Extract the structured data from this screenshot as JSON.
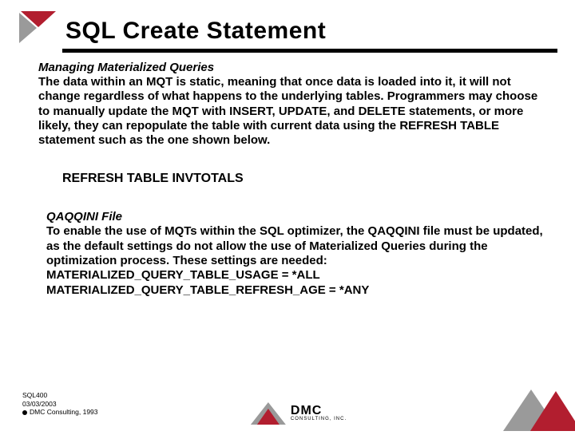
{
  "title": "SQL Create Statement",
  "section1": {
    "heading": "Managing Materialized Queries",
    "paragraph": "The data within an MQT is static, meaning that once data is loaded into it, it will not change regardless of what happens to the underlying tables. Programmers may choose to manually update the MQT with INSERT, UPDATE, and DELETE statements, or more likely, they can repopulate the table with current data using the REFRESH TABLE statement such as the one shown below."
  },
  "code": "REFRESH TABLE INVTOTALS",
  "section2": {
    "heading": "QAQQINI File",
    "paragraph": "To enable the use of MQTs within the SQL optimizer, the QAQQINI file must be updated, as the default settings do not allow the use of Materialized Queries during the optimization process. These settings are needed:",
    "settings": [
      "MATERIALIZED_QUERY_TABLE_USAGE = *ALL",
      "MATERIALIZED_QUERY_TABLE_REFRESH_AGE = *ANY"
    ]
  },
  "footer": {
    "code": "SQL400",
    "date": "03/03/2003",
    "copyright": "DMC Consulting, 1993"
  },
  "logo": {
    "name": "DMC",
    "sub": "CONSULTING, INC."
  }
}
